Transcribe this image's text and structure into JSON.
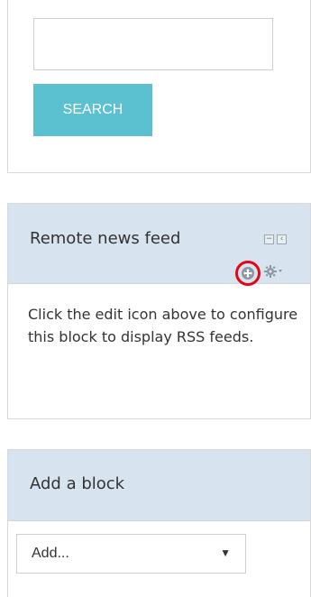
{
  "search_block": {
    "input_value": "",
    "button_label": "SEARCH"
  },
  "rss_block": {
    "title": "Remote news feed",
    "body_text": "Click the edit icon above to configure this block to display RSS feeds.",
    "highlight_color": "#e30613"
  },
  "add_block": {
    "title": "Add a block",
    "select_value": "Add...",
    "select_arrow": "▼"
  }
}
